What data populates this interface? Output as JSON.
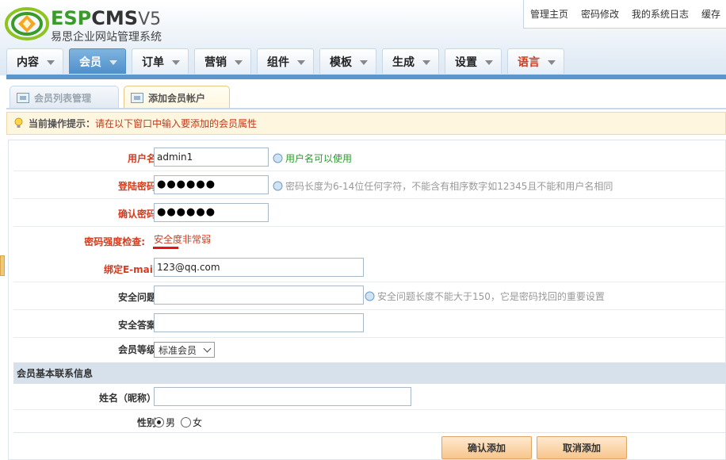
{
  "brand": {
    "esp": "ESP",
    "cms": "CMS",
    "version": "V5",
    "subtitle": "易思企业网站管理系统"
  },
  "top_links": [
    "管理主页",
    "密码修改",
    "我的系统日志",
    "缓存"
  ],
  "nav": {
    "tabs": [
      {
        "label": "内容",
        "width": 72,
        "active": false
      },
      {
        "label": "会员",
        "width": 72,
        "active": true
      },
      {
        "label": "订单",
        "width": 72,
        "active": false
      },
      {
        "label": "营销",
        "width": 72,
        "active": false
      },
      {
        "label": "组件",
        "width": 72,
        "active": false
      },
      {
        "label": "模板",
        "width": 72,
        "active": false
      },
      {
        "label": "生成",
        "width": 72,
        "active": false
      },
      {
        "label": "设置",
        "width": 72,
        "active": false
      },
      {
        "label": "语言",
        "width": 72,
        "active": false,
        "lang": true
      }
    ]
  },
  "subtabs": [
    {
      "label": "会员列表管理",
      "active": false
    },
    {
      "label": "添加会员帐户",
      "active": true
    }
  ],
  "hint": {
    "label": "当前操作提示：",
    "text": "请在以下窗口中输入要添加的会员属性"
  },
  "form": {
    "username": {
      "label": "用户名",
      "value": "admin1",
      "tip": "用户名可以使用"
    },
    "password": {
      "label": "登陆密码",
      "value": "●●●●●●",
      "tip": "密码长度为6-14位任何字符，不能含有相序数字如12345且不能和用户名相同"
    },
    "confirm": {
      "label": "确认密码",
      "value": "●●●●●●"
    },
    "strength": {
      "label": "密码强度检查:",
      "value": "安全度非常弱"
    },
    "email": {
      "label": "绑定E-mail",
      "value": "123@qq.com"
    },
    "question": {
      "label": "安全问题",
      "value": "",
      "tip": "安全问题长度不能大于150，它是密码找回的重要设置"
    },
    "answer": {
      "label": "安全答案",
      "value": ""
    },
    "level": {
      "label": "会员等级",
      "selected": "标准会员"
    },
    "section_title": "会员基本联系信息",
    "name": {
      "label": "姓名（昵称）",
      "value": ""
    },
    "gender": {
      "label": "性别",
      "male": "男",
      "female": "女",
      "selected": "男"
    }
  },
  "buttons": {
    "confirm": "确认添加",
    "cancel": "取消添加"
  },
  "colors": {
    "accent_blue": "#5b97cd",
    "label_red": "#d23c1e",
    "tip_green": "#2f9a2f",
    "button_orange": "#f7c58c"
  }
}
